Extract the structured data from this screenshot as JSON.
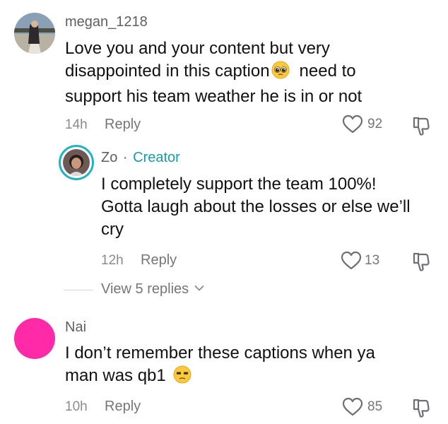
{
  "comments": [
    {
      "username": "megan_1218",
      "line1": "Love you and your content but very",
      "line2_a": "disappointed in this caption",
      "line2_b": "need to",
      "line3": "support his team weather he is in or not",
      "time": "14h",
      "reply_label": "Reply",
      "likes": "92",
      "emoji_icon": "pleading-face-icon"
    },
    {
      "username": "Zo",
      "separator": "·",
      "badge": "Creator",
      "line1": "I completely support the team 100%!",
      "line2": "Gotta laugh about the losses or else we’ll",
      "line3": "cry",
      "time": "12h",
      "reply_label": "Reply",
      "likes": "13",
      "view_replies": "View 5 replies"
    },
    {
      "username": "Nai",
      "line1": "I don’t remember these captions when ya",
      "line2": "man was qb1",
      "time": "10h",
      "reply_label": "Reply",
      "likes": "85",
      "emoji_icon": "unamused-face-icon"
    }
  ],
  "colors": {
    "creator_accent": "#1a9aa8",
    "avatar_pink": "#ff2aa8",
    "muted_text": "#75767c"
  }
}
